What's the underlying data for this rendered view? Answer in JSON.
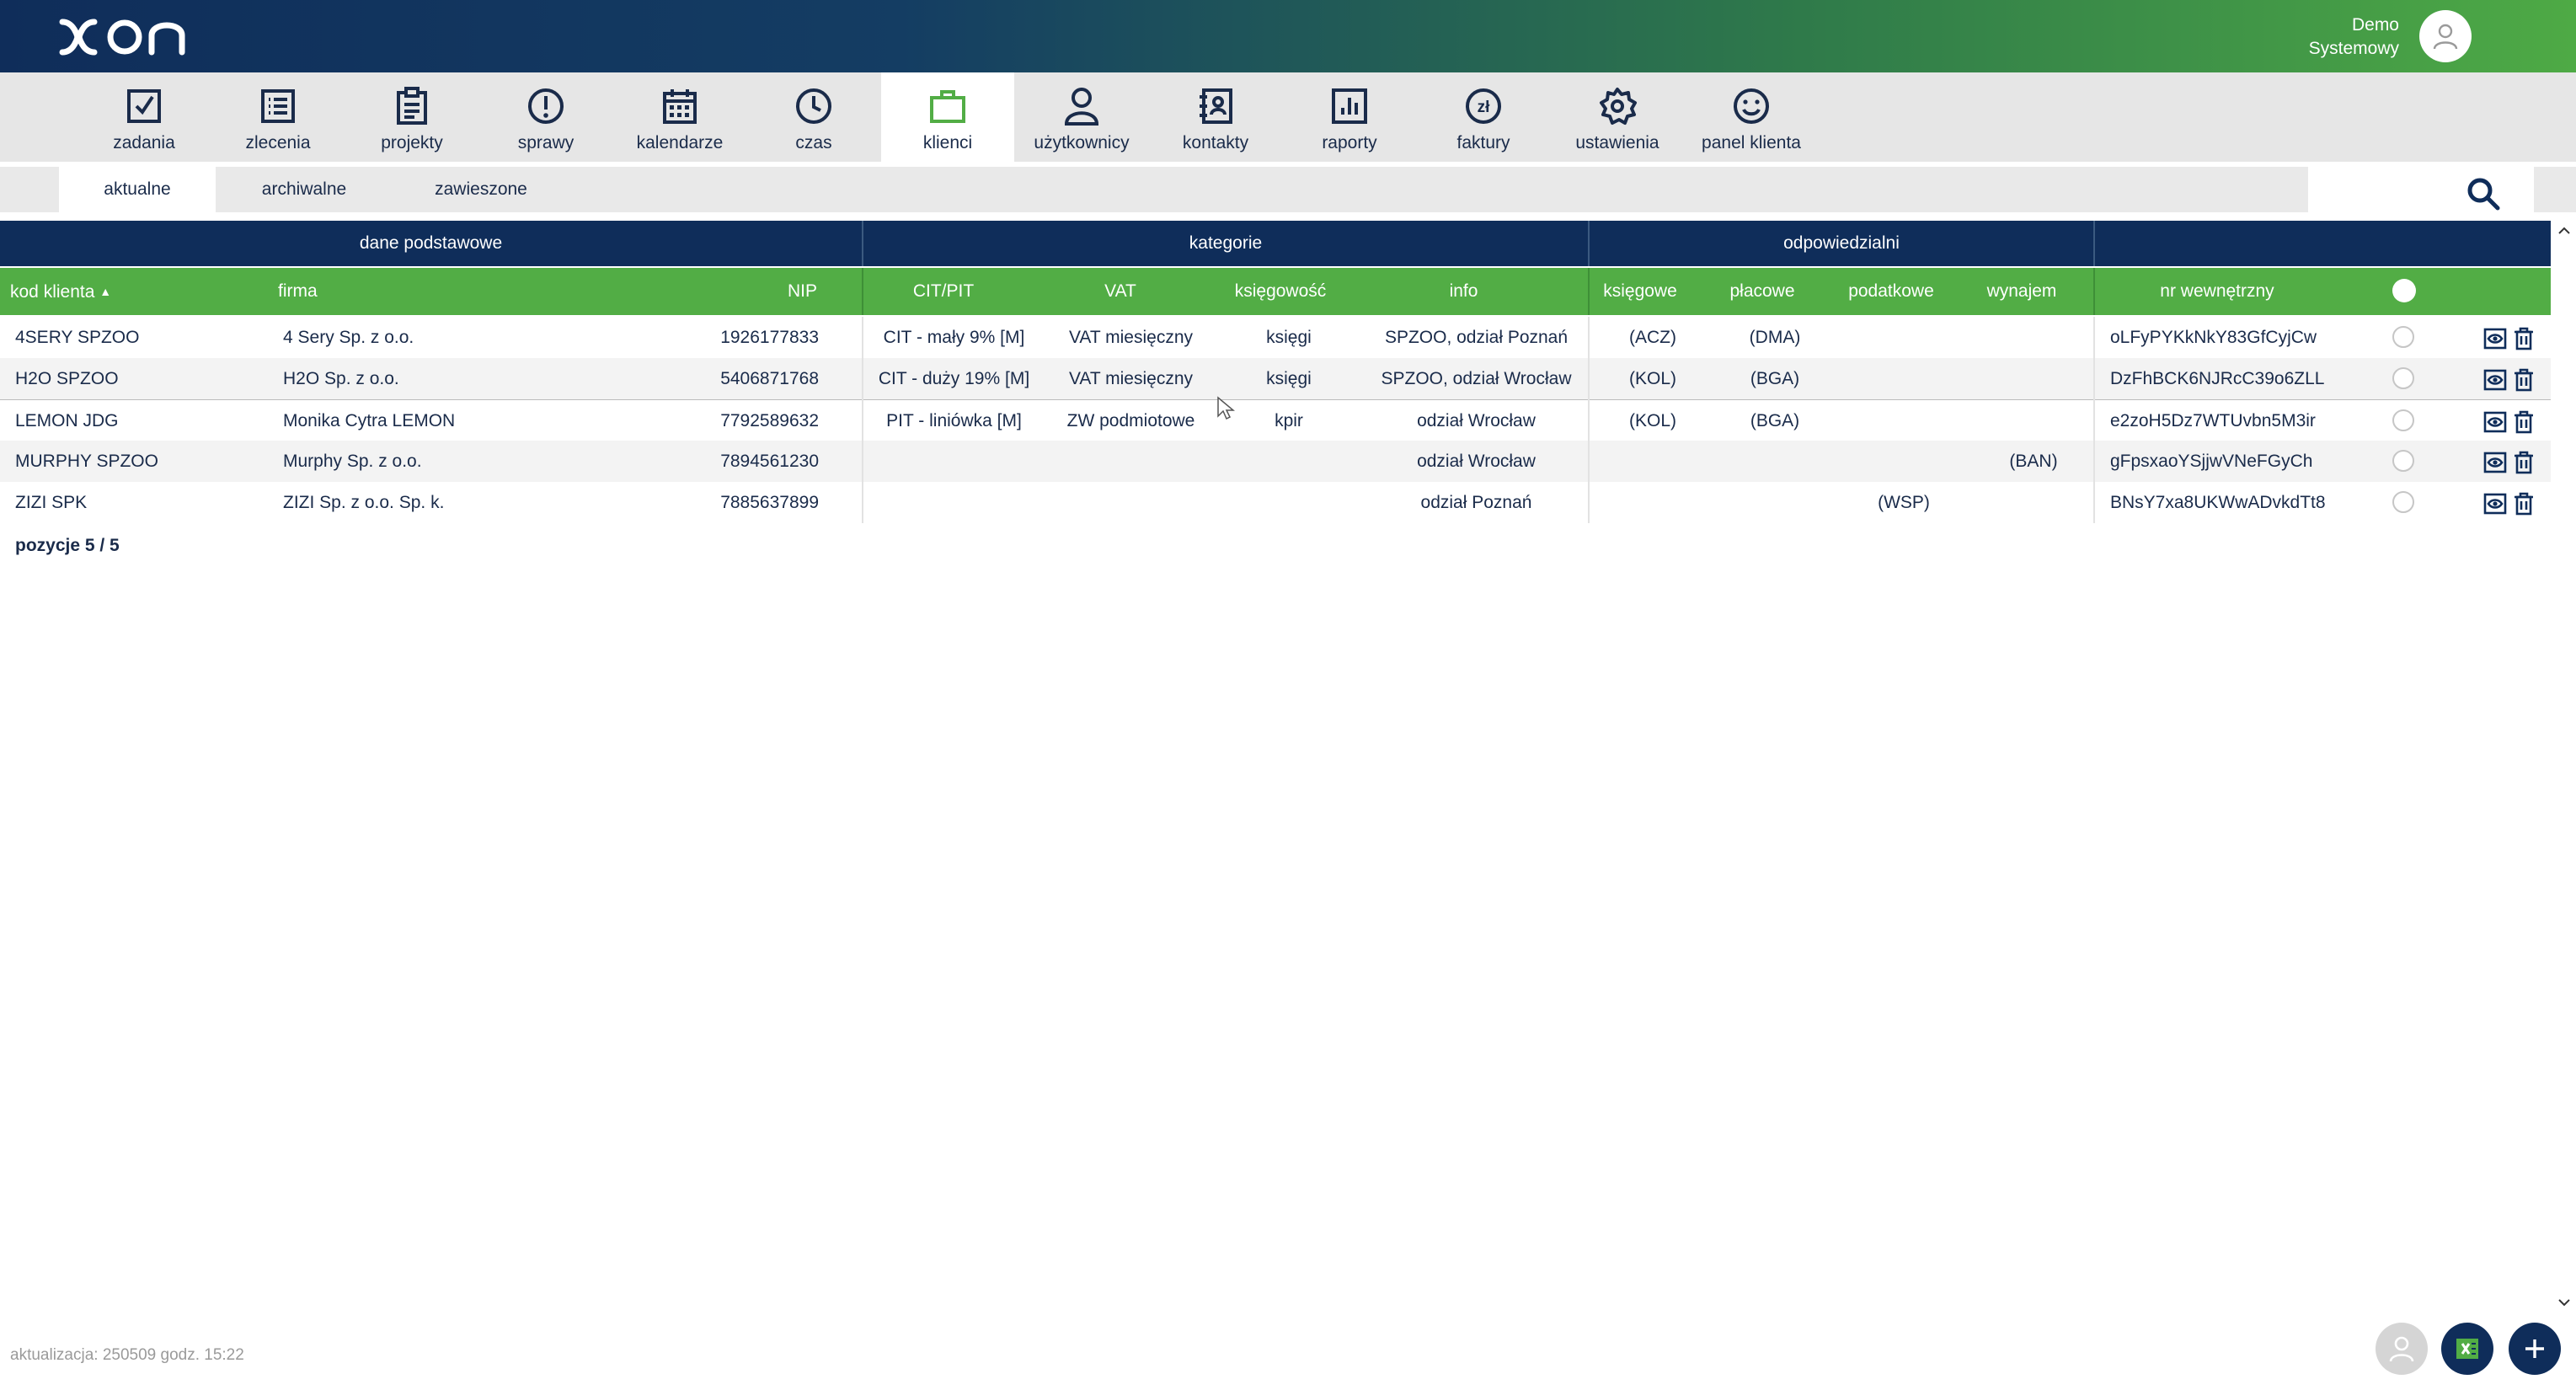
{
  "app": {
    "logo_text": "XON"
  },
  "user": {
    "name_line1": "Demo",
    "name_line2": "Systemowy"
  },
  "colors": {
    "header_start": "#0f2d5a",
    "header_end": "#4eaa45",
    "table_group": "#0f2d5a",
    "table_head": "#52ad45",
    "active_nav_icon": "#52ad45",
    "text": "#1a2b4a"
  },
  "nav": [
    {
      "label": "zadania",
      "icon": "checkbox-icon"
    },
    {
      "label": "zlecenia",
      "icon": "list-icon"
    },
    {
      "label": "projekty",
      "icon": "clipboard-icon"
    },
    {
      "label": "sprawy",
      "icon": "exclamation-icon"
    },
    {
      "label": "kalendarze",
      "icon": "calendar-icon"
    },
    {
      "label": "czas",
      "icon": "clock-icon"
    },
    {
      "label": "klienci",
      "icon": "briefcase-icon",
      "active": true
    },
    {
      "label": "użytkownicy",
      "icon": "person-icon"
    },
    {
      "label": "kontakty",
      "icon": "contact-book-icon"
    },
    {
      "label": "raporty",
      "icon": "bar-chart-icon"
    },
    {
      "label": "faktury",
      "icon": "invoice-zl-icon"
    },
    {
      "label": "ustawienia",
      "icon": "gear-icon"
    },
    {
      "label": "panel klienta",
      "icon": "smiley-icon"
    }
  ],
  "subtabs": [
    {
      "label": "aktualne",
      "active": true
    },
    {
      "label": "archiwalne"
    },
    {
      "label": "zawieszone"
    }
  ],
  "table": {
    "groups": [
      "dane podstawowe",
      "kategorie",
      "odpowiedzialni",
      ""
    ],
    "columns": [
      "kod klienta",
      "firma",
      "NIP",
      "CIT/PIT",
      "VAT",
      "księgowość",
      "info",
      "księgowe",
      "płacowe",
      "podatkowe",
      "wynajem",
      "nr wewnętrzny"
    ],
    "sorted_column": "kod klienta",
    "rows": [
      [
        "4SERY SPZOO",
        "4 Sery Sp. z o.o.",
        "1926177833",
        "CIT - mały 9% [M]",
        "VAT miesięczny",
        "księgi",
        "SPZOO, odział Poznań",
        "(ACZ)",
        "(DMA)",
        "",
        "",
        "oLFyPYKkNkY83GfCyjCw"
      ],
      [
        "H2O SPZOO",
        "H2O Sp. z o.o.",
        "5406871768",
        "CIT - duży 19% [M]",
        "VAT miesięczny",
        "księgi",
        "SPZOO, odział Wrocław",
        "(KOL)",
        "(BGA)",
        "",
        "",
        "DzFhBCK6NJRcC39o6ZLL"
      ],
      [
        "LEMON JDG",
        "Monika Cytra LEMON",
        "7792589632",
        "PIT - liniówka [M]",
        "ZW podmiotowe",
        "kpir",
        "odział Wrocław",
        "(KOL)",
        "(BGA)",
        "",
        "",
        "e2zoH5Dz7WTUvbn5M3ir"
      ],
      [
        "MURPHY SPZOO",
        "Murphy Sp. z o.o.",
        "7894561230",
        "",
        "",
        "",
        "odział Wrocław",
        "",
        "",
        "",
        "(BAN)",
        "gFpsxaoYSjjwVNeFGyCh"
      ],
      [
        "ZIZI SPK",
        "ZIZI Sp. z o.o. Sp. k.",
        "7885637899",
        "",
        "",
        "",
        "odział Poznań",
        "",
        "",
        "(WSP)",
        "",
        "BNsY7xa8UKWwADvkdTt8"
      ]
    ],
    "footer": "pozycje 5 / 5"
  },
  "status": {
    "updated": "aktualizacja: 250509 godz. 15:22"
  }
}
